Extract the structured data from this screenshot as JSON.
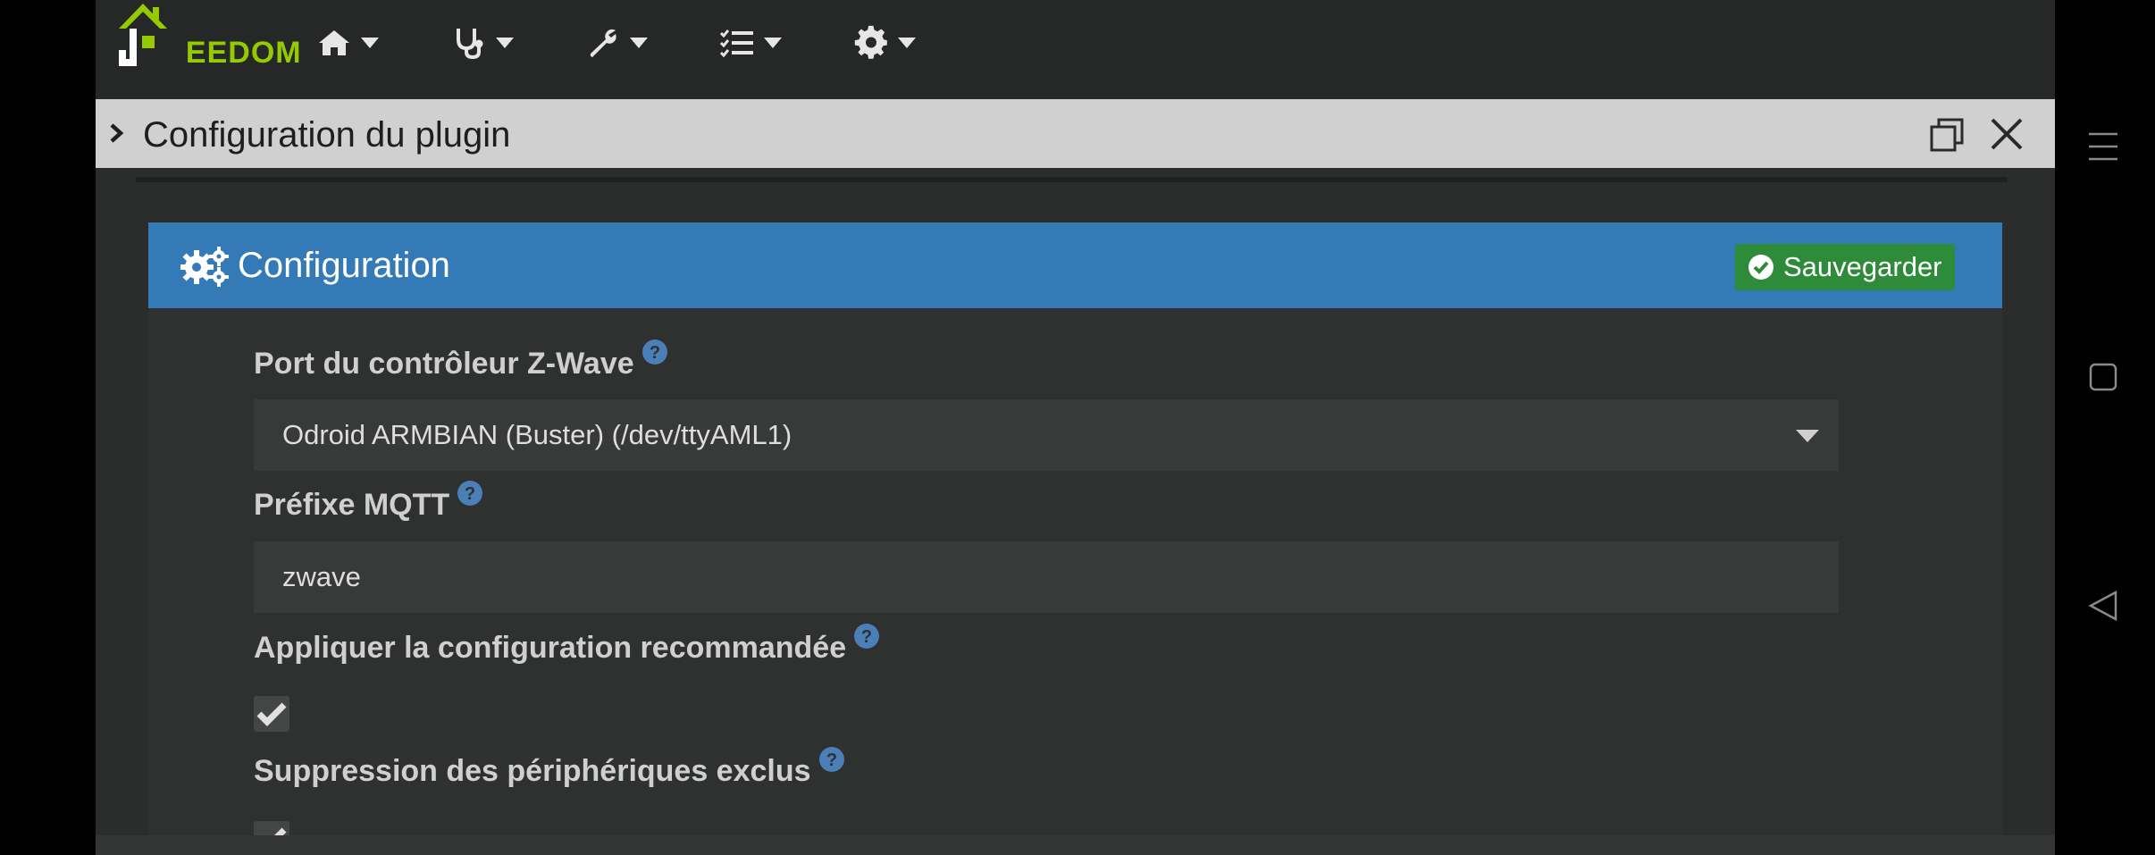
{
  "navbar": {
    "logo_text_white": "J",
    "logo_text_green": "EEDOM",
    "items": [
      {
        "icon": "home-icon"
      },
      {
        "icon": "stethoscope-icon"
      },
      {
        "icon": "wrench-icon"
      },
      {
        "icon": "tasks-icon"
      },
      {
        "icon": "gear-icon"
      }
    ]
  },
  "modal": {
    "title": "Configuration du plugin"
  },
  "panel": {
    "title": "Configuration",
    "save_label": "Sauvegarder"
  },
  "fields": {
    "port": {
      "label": "Port du contrôleur Z-Wave",
      "value": "Odroid ARMBIAN (Buster) (/dev/ttyAML1)"
    },
    "mqtt_prefix": {
      "label": "Préfixe MQTT",
      "value": "zwave"
    },
    "apply_recommended": {
      "label": "Appliquer la configuration recommandée",
      "checked": true
    },
    "delete_excluded": {
      "label": "Suppression des périphériques exclus",
      "checked": true
    }
  },
  "colors": {
    "panel_header": "#337ab7",
    "save_button": "#2e8b3a",
    "logo_green": "#94ca02",
    "help_icon": "#4a7fb8"
  }
}
